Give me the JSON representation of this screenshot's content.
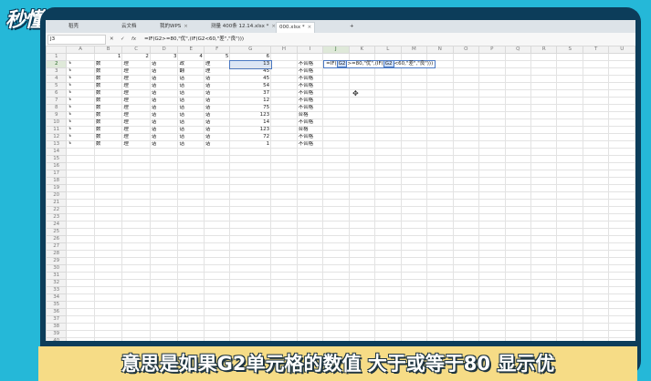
{
  "logo_text": "秒懂视频",
  "tabs": [
    {
      "label": "稻壳",
      "closable": false
    },
    {
      "label": "云文档",
      "closable": false
    },
    {
      "label": "我的WPS",
      "closable": true
    },
    {
      "label": "测量 400条 12.14.xlsx *",
      "closable": true
    },
    {
      "label": "000.xlsx *",
      "closable": true,
      "active": true
    }
  ],
  "new_tab_label": "+",
  "formula_bar": {
    "cell_ref": "J3",
    "fx_label": "fx",
    "formula": "=IF(G2>=80,\"优\",(IF(G2<60,\"差\",\"良\")))"
  },
  "columns": [
    "A",
    "B",
    "C",
    "D",
    "E",
    "F",
    "G",
    "H",
    "I",
    "J",
    "K",
    "L",
    "M",
    "N",
    "O",
    "P",
    "Q",
    "R",
    "S",
    "T",
    "U"
  ],
  "header_row_values": [
    "",
    "1",
    "2",
    "3",
    "4",
    "5",
    "6",
    "",
    "",
    "",
    "",
    "",
    "",
    "",
    "",
    "",
    "",
    "",
    "",
    "",
    ""
  ],
  "rows": [
    {
      "n": "2",
      "c": [
        "数",
        "理",
        "话",
        "政",
        "理"
      ],
      "g": "13",
      "i": "不合格"
    },
    {
      "n": "3",
      "c": [
        "数",
        "理",
        "话",
        "翻",
        "理"
      ],
      "g": "45",
      "i": "不合格"
    },
    {
      "n": "4",
      "c": [
        "数",
        "理",
        "话",
        "话",
        "话"
      ],
      "g": "45",
      "i": "不合格"
    },
    {
      "n": "5",
      "c": [
        "数",
        "理",
        "话",
        "话",
        "话"
      ],
      "g": "54",
      "i": "不合格"
    },
    {
      "n": "6",
      "c": [
        "数",
        "理",
        "话",
        "话",
        "话"
      ],
      "g": "37",
      "i": "不合格"
    },
    {
      "n": "7",
      "c": [
        "数",
        "理",
        "话",
        "话",
        "话"
      ],
      "g": "12",
      "i": "不合格"
    },
    {
      "n": "8",
      "c": [
        "数",
        "理",
        "话",
        "话",
        "话"
      ],
      "g": "75",
      "i": "不合格"
    },
    {
      "n": "9",
      "c": [
        "数",
        "理",
        "话",
        "话",
        "话"
      ],
      "g": "123",
      "i": "合格"
    },
    {
      "n": "10",
      "c": [
        "数",
        "理",
        "话",
        "话",
        "话"
      ],
      "g": "14",
      "i": "不合格"
    },
    {
      "n": "11",
      "c": [
        "数",
        "理",
        "话",
        "话",
        "话"
      ],
      "g": "123",
      "i": "合格"
    },
    {
      "n": "12",
      "c": [
        "数",
        "理",
        "话",
        "话",
        "话"
      ],
      "g": "72",
      "i": "不合格"
    },
    {
      "n": "13",
      "c": [
        "数",
        "理",
        "话",
        "话",
        "话"
      ],
      "g": "1",
      "i": "不合格"
    }
  ],
  "empty_row_numbers": [
    "14",
    "15",
    "16",
    "17",
    "18",
    "19",
    "20",
    "21",
    "22",
    "23",
    "24",
    "25",
    "26",
    "27",
    "28",
    "29",
    "30",
    "31",
    "32",
    "33",
    "34",
    "35",
    "36",
    "37",
    "38",
    "39",
    "40"
  ],
  "edit_cell": {
    "prefix": "=IF(",
    "ref1": "G2",
    "mid": ">=80,\"优\",(IF(",
    "ref2": "G2",
    "suffix": "<60,\"差\",\"良\")))"
  },
  "cursor_glyph": "✥",
  "caption": "意思是如果G2单元格的数值 大于或等于80 显示优"
}
